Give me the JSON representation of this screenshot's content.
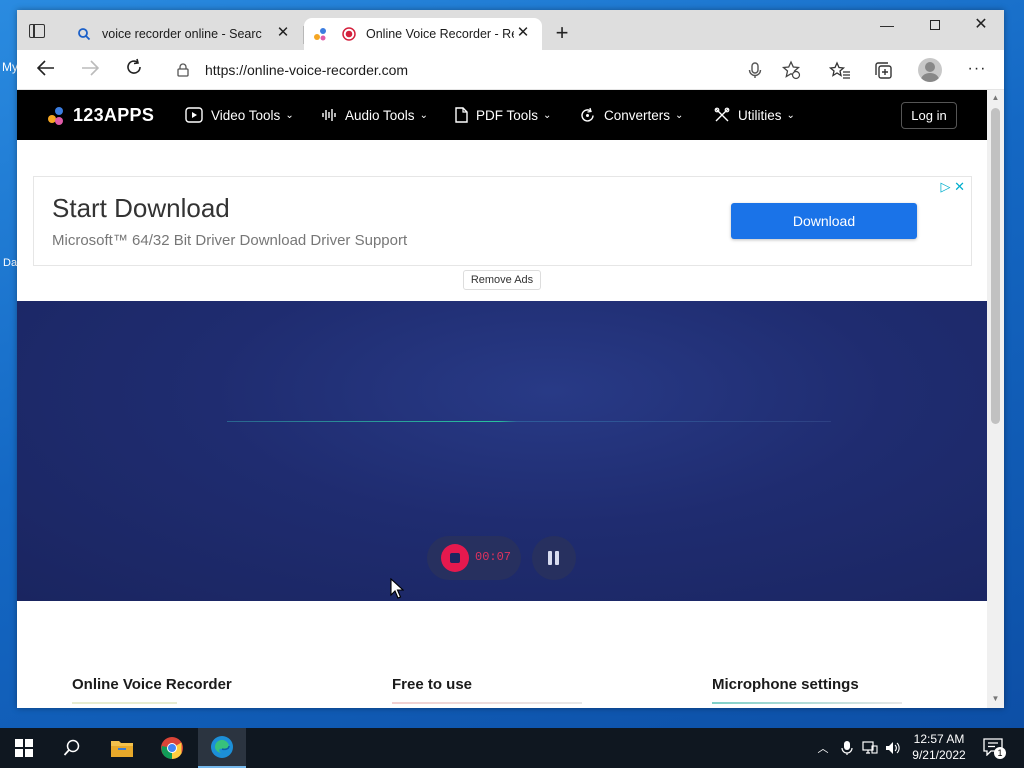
{
  "desktop": {
    "fragments": [
      "My",
      "Da"
    ]
  },
  "browser": {
    "tabs": [
      {
        "title": "voice recorder online - Search",
        "icon": "search-icon",
        "active": false
      },
      {
        "title": "Online Voice Recorder - Recor",
        "icon": "record-icon",
        "active": true
      }
    ],
    "url": "https://online-voice-recorder.com"
  },
  "site": {
    "logo": "123APPS",
    "menu": [
      {
        "label": "Video Tools",
        "icon": "video-icon"
      },
      {
        "label": "Audio Tools",
        "icon": "audio-icon"
      },
      {
        "label": "PDF Tools",
        "icon": "pdf-icon"
      },
      {
        "label": "Converters",
        "icon": "converter-icon"
      },
      {
        "label": "Utilities",
        "icon": "utilities-icon"
      }
    ],
    "login_label": "Log in"
  },
  "ad": {
    "title": "Start Download",
    "subtitle": "Microsoft™ 64/32 Bit Driver Download Driver Support",
    "button_label": "Download",
    "remove_ads_label": "Remove Ads"
  },
  "recorder": {
    "timer": "00:07",
    "state": "recording"
  },
  "features": [
    {
      "title": "Online Voice Recorder",
      "accent": "#e8ecd0"
    },
    {
      "title": "Free to use",
      "accent": "#f2d0d0"
    },
    {
      "title": "Microphone settings",
      "accent": "#7fd0c8"
    }
  ],
  "taskbar": {
    "time": "12:57 AM",
    "date": "9/21/2022",
    "notification_count": "1"
  },
  "colors": {
    "accent_blue": "#1a73e8",
    "record_red": "#e5194e",
    "recorder_bg": "#1f2c70"
  }
}
